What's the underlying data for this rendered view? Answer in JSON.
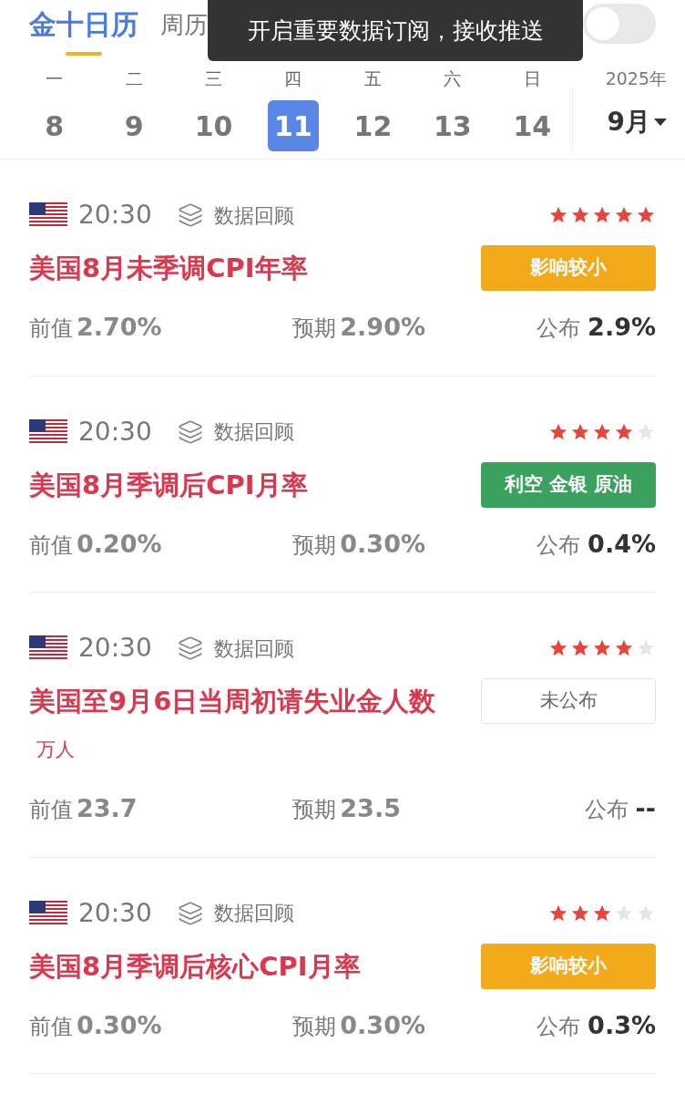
{
  "tabs": [
    {
      "label": "金十日历",
      "selected": true
    },
    {
      "label": "周历",
      "selected": false
    }
  ],
  "toast": "开启重要数据订阅，接收推送",
  "important_toggle": {
    "on": false
  },
  "week": [
    {
      "weekday": "一",
      "day": "8",
      "selected": false
    },
    {
      "weekday": "二",
      "day": "9",
      "selected": false
    },
    {
      "weekday": "三",
      "day": "10",
      "selected": false
    },
    {
      "weekday": "四",
      "day": "11",
      "selected": true
    },
    {
      "weekday": "五",
      "day": "12",
      "selected": false
    },
    {
      "weekday": "六",
      "day": "13",
      "selected": false
    },
    {
      "weekday": "日",
      "day": "14",
      "selected": false
    }
  ],
  "year": "2025年",
  "month": "9月",
  "events": [
    {
      "time": "20:30",
      "review": "数据回顾",
      "stars": 5,
      "title": "美国8月未季调CPI年率",
      "badge": {
        "kind": "impact",
        "label": "影响较小"
      },
      "previous_label": "前值",
      "previous": "2.70%",
      "forecast_label": "预期",
      "forecast": "2.90%",
      "actual_label": "公布",
      "actual": "2.9%"
    },
    {
      "time": "20:30",
      "review": "数据回顾",
      "stars": 4,
      "title": "美国8月季调后CPI月率",
      "badge": {
        "kind": "bearish",
        "label": "利空 金银 原油"
      },
      "previous_label": "前值",
      "previous": "0.20%",
      "forecast_label": "预期",
      "forecast": "0.30%",
      "actual_label": "公布",
      "actual": "0.4%"
    },
    {
      "time": "20:30",
      "review": "数据回顾",
      "stars": 4,
      "title": "美国至9月6日当周初请失业金人数",
      "unit": "万人",
      "badge": {
        "kind": "pending",
        "label": "未公布"
      },
      "previous_label": "前值",
      "previous": "23.7",
      "forecast_label": "预期",
      "forecast": "23.5",
      "actual_label": "公布",
      "actual": "--"
    },
    {
      "time": "20:30",
      "review": "数据回顾",
      "stars": 3,
      "title": "美国8月季调后核心CPI月率",
      "badge": {
        "kind": "impact",
        "label": "影响较小"
      },
      "previous_label": "前值",
      "previous": "0.30%",
      "forecast_label": "预期",
      "forecast": "0.30%",
      "actual_label": "公布",
      "actual": "0.3%"
    }
  ]
}
